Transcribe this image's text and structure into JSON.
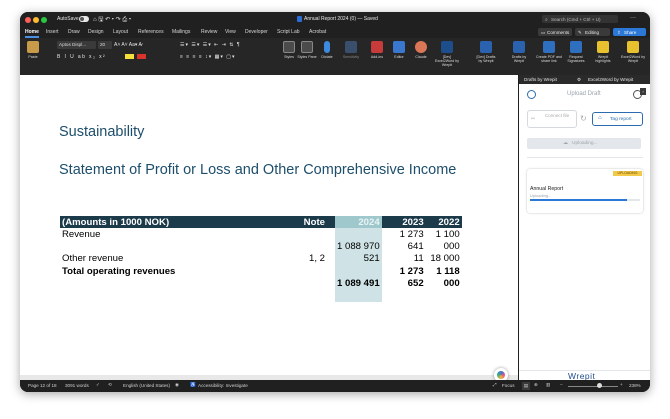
{
  "window": {
    "autosave_label": "AutoSave",
    "doc_title": "Annual Report 2024 (0) — Saved",
    "search_placeholder": "Search (Cmd + Ctrl + U)"
  },
  "menu": {
    "items": [
      "Home",
      "Insert",
      "Draw",
      "Design",
      "Layout",
      "References",
      "Mailings",
      "Review",
      "View",
      "Developer",
      "Script Lab",
      "Acrobat"
    ],
    "comments_label": "Comments",
    "editing_label": "Editing",
    "share_label": "Share"
  },
  "ribbon": {
    "paste_label": "Paste",
    "font_name": "Aptos Displ...",
    "font_size": "20",
    "styles_label": "Styles",
    "styles_pane_label": "Styles Pane",
    "dictate_label": "Dictate",
    "sensitivity_label": "Sensitivity",
    "add_ins_label": "Add-ins",
    "editor_label": "Editor",
    "claude_label": "Claude",
    "dev_excel2word_label": "[Dev] Excel2Word by Wrepit",
    "dev_drafts_label": "[Dev] Drafts by Wrepit",
    "drafts_label": "Drafts by Wrepit",
    "create_pdf_label": "Create PDF and share link",
    "request_sig_label": "Request Signatures",
    "wrepit_highlights_label": "Wrepit highlights",
    "excel2word_label": "Excel2Word by Wrepit"
  },
  "document": {
    "heading_sustainability": "Sustainability",
    "heading_statement": "Statement of Profit or Loss and Other Comprehensive Income",
    "table": {
      "header": {
        "label": "(Amounts in 1000 NOK)",
        "note": "Note",
        "y2024": "2024",
        "y2023": "2023",
        "y2022": "2022"
      },
      "rows": [
        {
          "label": "Revenue",
          "note": "",
          "y2024": "",
          "y2023": "1 273",
          "y2022": "1 100",
          "bold": false
        },
        {
          "label": "",
          "note": "",
          "y2024": "1 088 970",
          "y2023": "641",
          "y2022": "000",
          "bold": false
        },
        {
          "label": "Other revenue",
          "note": "1, 2",
          "y2024": "521",
          "y2023": "11",
          "y2022": "18 000",
          "bold": false
        },
        {
          "label": "Total operating revenues",
          "note": "",
          "y2024": "",
          "y2023": "1 273",
          "y2022": "1 118",
          "bold": true
        },
        {
          "label": "",
          "note": "",
          "y2024": "1 089 491",
          "y2023": "652",
          "y2022": "000",
          "bold": true
        }
      ]
    }
  },
  "taskpane": {
    "tabs": [
      "Drafts by Wrepit",
      "Excel2Word by Wrepit"
    ],
    "upload_draft_label": "Upload Draft",
    "connect_file_label": "Connect file",
    "tag_report_label": "Tag report",
    "uploading_button_label": "Uploading...",
    "card": {
      "badge": "UPLOADING",
      "title": "Annual Report",
      "status": "Uploading...",
      "progress": 0.88
    },
    "brand": "Wrepit"
  },
  "status": {
    "page": "Page 12 of 18",
    "words": "3091 words",
    "language": "English (United States)",
    "accessibility": "Accessibility: Investigate",
    "focus": "Focus",
    "zoom": "238%"
  },
  "colors": {
    "heading": "#1d4e6c",
    "table_header": "#1b3a4a",
    "col_2024": "#cfe3e6",
    "accent_blue": "#2b78d6"
  }
}
